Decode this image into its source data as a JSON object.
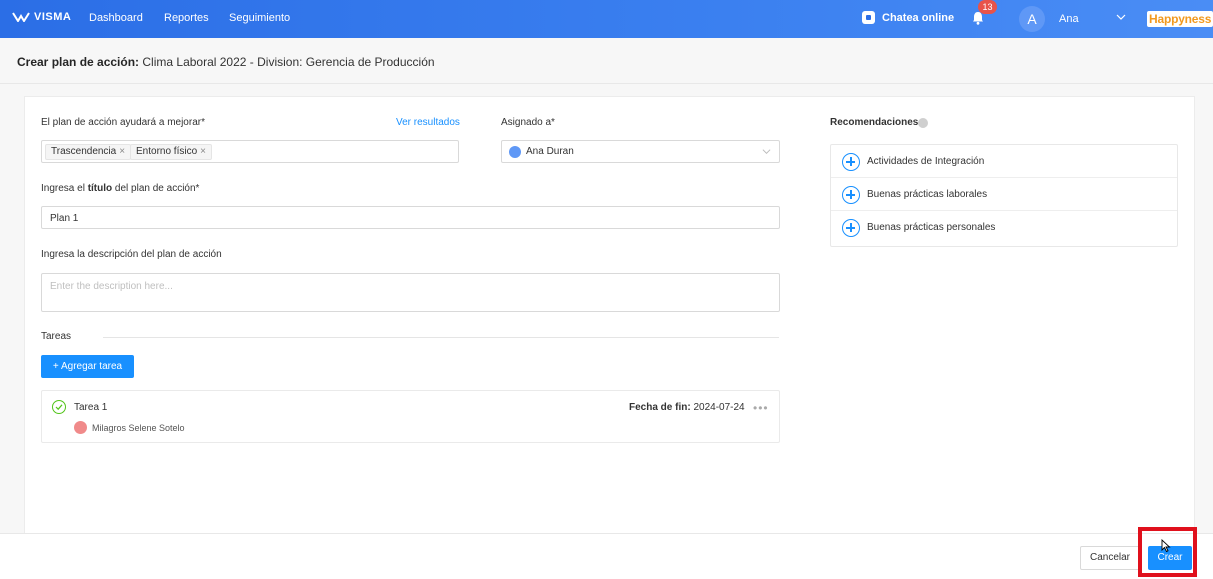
{
  "topbar": {
    "logo": "VISMA",
    "nav": [
      "Dashboard",
      "Reportes",
      "Seguimiento"
    ],
    "chat_label": "Chatea online",
    "notifications_count": "13",
    "user_initial": "A",
    "user_name": "Ana",
    "brand": "Happyness"
  },
  "header": {
    "title_prefix": "Crear plan de acción:",
    "title_rest": "Clima Laboral 2022 - Division: Gerencia de Producción"
  },
  "form": {
    "improve_label": "El plan de acción ayudará a mejorar*",
    "results_link": "Ver resultados",
    "tags": [
      "Trascendencia",
      "Entorno físico"
    ],
    "assigned_label": "Asignado a*",
    "assigned_value": "Ana Duran",
    "title_label_pre": "Ingresa el ",
    "title_label_bold": "título",
    "title_label_post": " del plan de acción*",
    "title_value": "Plan 1",
    "description_label": "Ingresa la descripción del plan de acción",
    "description_placeholder": "Enter the description here..."
  },
  "tasks": {
    "section_label": "Tareas",
    "add_button": "+ Agregar tarea",
    "items": [
      {
        "name": "Tarea 1",
        "user": "Milagros Selene Sotelo",
        "date_label": "Fecha de fin:",
        "date_value": "2024-07-24"
      }
    ]
  },
  "recommendations": {
    "title": "Recomendaciones",
    "items": [
      "Actividades de Integración",
      "Buenas prácticas laborales",
      "Buenas prácticas personales"
    ]
  },
  "footer": {
    "cancel": "Cancelar",
    "create": "Crear"
  },
  "colors": {
    "primary": "#1890ff",
    "topbar": "#2b6ee6",
    "highlight": "#e0101c",
    "brand": "#f29a1f"
  }
}
